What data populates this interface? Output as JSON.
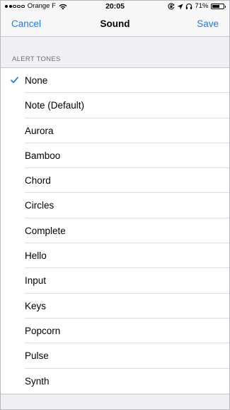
{
  "status_bar": {
    "carrier": "Orange F",
    "time": "20:05",
    "battery_percent": "71%",
    "battery_level": 0.71,
    "signal_bars_filled": 2,
    "signal_bars_total": 5,
    "icons": [
      "wifi-icon",
      "orientation-lock-icon",
      "location-arrow-icon",
      "headphones-icon",
      "battery-icon"
    ]
  },
  "nav": {
    "cancel_label": "Cancel",
    "title": "Sound",
    "save_label": "Save"
  },
  "section": {
    "header": "ALERT TONES"
  },
  "tones": [
    {
      "label": "None",
      "selected": true
    },
    {
      "label": "Note (Default)",
      "selected": false
    },
    {
      "label": "Aurora",
      "selected": false
    },
    {
      "label": "Bamboo",
      "selected": false
    },
    {
      "label": "Chord",
      "selected": false
    },
    {
      "label": "Circles",
      "selected": false
    },
    {
      "label": "Complete",
      "selected": false
    },
    {
      "label": "Hello",
      "selected": false
    },
    {
      "label": "Input",
      "selected": false
    },
    {
      "label": "Keys",
      "selected": false
    },
    {
      "label": "Popcorn",
      "selected": false
    },
    {
      "label": "Pulse",
      "selected": false
    },
    {
      "label": "Synth",
      "selected": false
    }
  ],
  "colors": {
    "accent": "#147efb",
    "background": "#efeff4",
    "separator": "#c8c7cc",
    "section_header": "#6d6d72"
  }
}
